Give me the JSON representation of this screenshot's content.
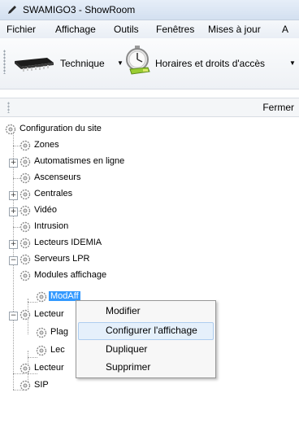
{
  "window": {
    "title": "SWAMIGO3 - ShowRoom"
  },
  "menu": [
    "Fichier",
    "Affichage",
    "Outils",
    "Fenêtres",
    "Mises à jour",
    "A"
  ],
  "toolbar": {
    "technique_label": "Technique",
    "horaires_label": "Horaires et droits d'accès"
  },
  "panel": {
    "close_label": "Fermer"
  },
  "tree": {
    "root": "Configuration du site",
    "items": [
      "Zones",
      "Automatismes en ligne",
      "Ascenseurs",
      "Centrales",
      "Vidéo",
      "Intrusion",
      "Lecteurs IDEMIA",
      "Serveurs LPR",
      "Modules affichage",
      "ModAff",
      "Lecteur",
      "Plag",
      "Lec",
      "Lecteur",
      "SIP"
    ]
  },
  "context_menu": [
    "Modifier",
    "Configurer l'affichage",
    "Dupliquer",
    "Supprimer"
  ]
}
